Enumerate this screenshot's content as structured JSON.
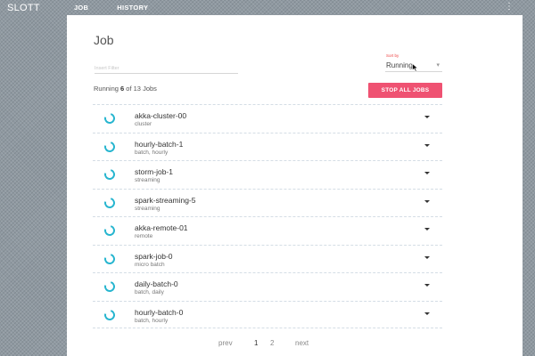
{
  "app": {
    "title": "SLOTT"
  },
  "nav": {
    "items": [
      {
        "label": "JOB"
      },
      {
        "label": "HISTORY"
      }
    ]
  },
  "menu": {
    "icon": "more-vert-icon",
    "glyph": "⋮"
  },
  "page": {
    "title": "Job"
  },
  "filter": {
    "placeholder": "Insert Filter",
    "value": ""
  },
  "sort": {
    "label": "Sort by",
    "value": "Running",
    "caret": "▾"
  },
  "summary": {
    "prefix": "Running ",
    "running": "6",
    "middle": " of ",
    "total": "13",
    "suffix": " Jobs"
  },
  "stop_button": {
    "label": "STOP ALL JOBS"
  },
  "colors": {
    "accent": "#ef5272",
    "spinner": "#26b5cf",
    "sort_label": "#ee4444"
  },
  "jobs": [
    {
      "name": "akka-cluster-00",
      "tags": "cluster",
      "status_icon": "loading-spinner-icon"
    },
    {
      "name": "hourly-batch-1",
      "tags": "batch, hourly",
      "status_icon": "loading-spinner-icon"
    },
    {
      "name": "storm-job-1",
      "tags": "streaming",
      "status_icon": "loading-spinner-icon"
    },
    {
      "name": "spark-streaming-5",
      "tags": "streaming",
      "status_icon": "loading-spinner-icon"
    },
    {
      "name": "akka-remote-01",
      "tags": "remote",
      "status_icon": "loading-spinner-icon"
    },
    {
      "name": "spark-job-0",
      "tags": "micro batch",
      "status_icon": "loading-spinner-icon"
    },
    {
      "name": "daily-batch-0",
      "tags": "batch, daily",
      "status_icon": "loading-spinner-icon"
    },
    {
      "name": "hourly-batch-0",
      "tags": "batch, hourly",
      "status_icon": "loading-spinner-icon"
    }
  ],
  "pagination": {
    "prev": "prev",
    "pages": [
      "1",
      "2"
    ],
    "next": "next",
    "current": "1"
  }
}
